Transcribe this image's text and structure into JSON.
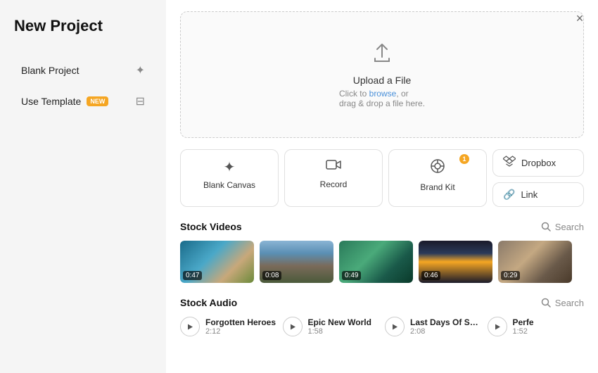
{
  "sidebar": {
    "title": "New Project",
    "items": [
      {
        "id": "blank-project",
        "label": "Blank Project",
        "badge": null
      },
      {
        "id": "use-template",
        "label": "Use Template",
        "badge": "NEW"
      }
    ]
  },
  "upload": {
    "title": "Upload a File",
    "subtitle_prefix": "Click to ",
    "link_text": "browse",
    "subtitle_suffix": ", or",
    "subtitle2": "drag & drop a file here."
  },
  "sources": [
    {
      "id": "blank-canvas",
      "label": "Blank Canvas",
      "icon": "✦"
    },
    {
      "id": "record",
      "label": "Record",
      "icon": "▭"
    },
    {
      "id": "brand-kit",
      "label": "Brand Kit",
      "icon": "◈",
      "notification": "1"
    }
  ],
  "source_right": [
    {
      "id": "dropbox",
      "label": "Dropbox",
      "icon": "⬡"
    },
    {
      "id": "link",
      "label": "Link",
      "icon": "🔗"
    }
  ],
  "stock_videos": {
    "title": "Stock Videos",
    "search_label": "Search",
    "items": [
      {
        "duration": "0:47",
        "theme": "ocean"
      },
      {
        "duration": "0:08",
        "theme": "mountain"
      },
      {
        "duration": "0:49",
        "theme": "aerial"
      },
      {
        "duration": "0:46",
        "theme": "city"
      },
      {
        "duration": "0:29",
        "theme": "people"
      }
    ]
  },
  "stock_audio": {
    "title": "Stock Audio",
    "search_label": "Search",
    "items": [
      {
        "id": "forgotten-heroes",
        "title": "Forgotten Heroes",
        "duration": "2:12"
      },
      {
        "id": "epic-new-world",
        "title": "Epic New World",
        "duration": "1:58"
      },
      {
        "id": "last-days",
        "title": "Last Days Of Su...",
        "duration": "2:08"
      },
      {
        "id": "perfe",
        "title": "Perfe",
        "duration": "1:52"
      }
    ]
  },
  "close_label": "×"
}
